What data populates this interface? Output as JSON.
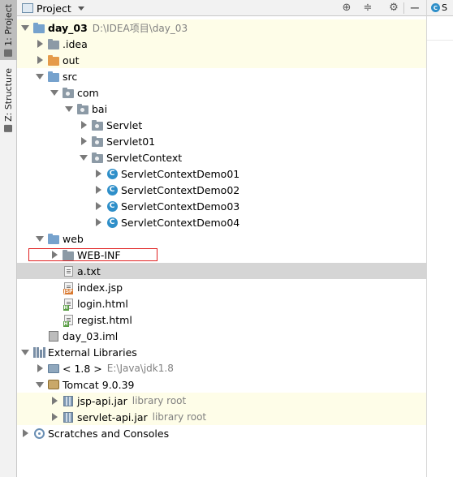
{
  "sidebar": {
    "project_tab": "1: Project",
    "structure_tab": "Z: Structure"
  },
  "header": {
    "title": "Project",
    "buttons": [
      "target-icon",
      "collapse-icon",
      "gear-icon",
      "hide-icon"
    ]
  },
  "editor": {
    "tab_label": "S"
  },
  "tree": [
    {
      "label": "day_03",
      "sub": "D:\\IDEA项目\\day_03",
      "icon": "module-folder-icon",
      "arrow": "down",
      "bold": true
    },
    {
      "label": ".idea",
      "sub": "",
      "icon": "folder-icon",
      "arrow": "right"
    },
    {
      "label": "out",
      "sub": "",
      "icon": "folder-orange-icon",
      "arrow": "right"
    },
    {
      "label": "src",
      "sub": "",
      "icon": "folder-blue-icon",
      "arrow": "down"
    },
    {
      "label": "com",
      "sub": "",
      "icon": "package-icon",
      "arrow": "down"
    },
    {
      "label": "bai",
      "sub": "",
      "icon": "package-icon",
      "arrow": "down"
    },
    {
      "label": "Servlet",
      "sub": "",
      "icon": "package-icon",
      "arrow": "right"
    },
    {
      "label": "Servlet01",
      "sub": "",
      "icon": "package-icon",
      "arrow": "right"
    },
    {
      "label": "ServletContext",
      "sub": "",
      "icon": "package-icon",
      "arrow": "down"
    },
    {
      "label": "ServletContextDemo01",
      "sub": "",
      "icon": "class-icon",
      "arrow": "right"
    },
    {
      "label": "ServletContextDemo02",
      "sub": "",
      "icon": "class-icon",
      "arrow": "right"
    },
    {
      "label": "ServletContextDemo03",
      "sub": "",
      "icon": "class-icon",
      "arrow": "right"
    },
    {
      "label": "ServletContextDemo04",
      "sub": "",
      "icon": "class-icon",
      "arrow": "right"
    },
    {
      "label": "web",
      "sub": "",
      "icon": "web-folder-icon",
      "arrow": "down"
    },
    {
      "label": "WEB-INF",
      "sub": "",
      "icon": "folder-icon",
      "arrow": "right"
    },
    {
      "label": "a.txt",
      "sub": "",
      "icon": "text-file-icon",
      "arrow": "none"
    },
    {
      "label": "index.jsp",
      "sub": "",
      "icon": "jsp-file-icon",
      "arrow": "none"
    },
    {
      "label": "login.html",
      "sub": "",
      "icon": "html-file-icon",
      "arrow": "none"
    },
    {
      "label": "regist.html",
      "sub": "",
      "icon": "html-file-icon",
      "arrow": "none"
    },
    {
      "label": "day_03.iml",
      "sub": "",
      "icon": "iml-file-icon",
      "arrow": "none"
    },
    {
      "label": "External Libraries",
      "sub": "",
      "icon": "libraries-icon",
      "arrow": "down"
    },
    {
      "label": "< 1.8 >",
      "sub": "E:\\Java\\jdk1.8",
      "icon": "jdk-icon",
      "arrow": "right"
    },
    {
      "label": "Tomcat 9.0.39",
      "sub": "",
      "icon": "tomcat-icon",
      "arrow": "down"
    },
    {
      "label": "jsp-api.jar",
      "sub": "library root",
      "icon": "jar-icon",
      "arrow": "right"
    },
    {
      "label": "servlet-api.jar",
      "sub": "library root",
      "icon": "jar-icon",
      "arrow": "right"
    },
    {
      "label": "Scratches and Consoles",
      "sub": "",
      "icon": "scratches-icon",
      "arrow": "right"
    }
  ],
  "colors": {
    "highlight_row": "#fefde8",
    "selected_row": "#d5d5d5",
    "selection_box": "#e02020",
    "class_icon": "#2f8fc9"
  }
}
